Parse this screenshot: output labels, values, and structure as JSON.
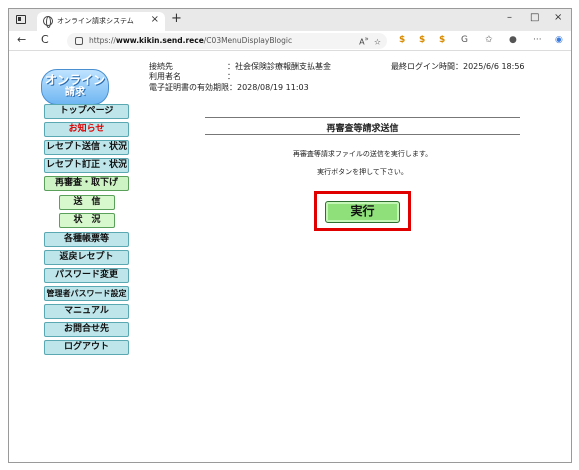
{
  "browser": {
    "tab_title": "オンライン請求システム",
    "tab_close": "×",
    "new_tab": "+",
    "window_controls": {
      "minimize": "–",
      "maximize": "□",
      "close": "×"
    },
    "url_prefix": "https://",
    "url_host": "www.kikin.send.rece",
    "url_path": "/C03MenuDisplayBlogic",
    "nav": {
      "back": "←",
      "reload": "C"
    }
  },
  "logo": {
    "line1": "オンライン",
    "line2": "請求"
  },
  "header": {
    "connection_label": "接続先",
    "connection_value": "：社会保険診療報酬支払基金",
    "user_label": "利用者名",
    "user_value": "：",
    "cert_label": "電子証明書の有効期限：2028/08/19 11:03",
    "last_login": "最終ログイン時間：2025/6/6 18:56"
  },
  "menu": {
    "top": "トップページ",
    "news": "お知らせ",
    "send_status": "レセプト送信・状況",
    "correction": "レセプト訂正・状況",
    "reexam": "再審査・取下げ",
    "sub_send": "送　信",
    "sub_status": "状　況",
    "forms": "各種帳票等",
    "returned": "返戻レセプト",
    "password": "パスワード変更",
    "admin_password": "管理者パスワード設定",
    "manual": "マニュアル",
    "contact": "お問合せ先",
    "logout": "ログアウト"
  },
  "main": {
    "title": "再審査等請求送信",
    "message1": "再審査等請求ファイルの送信を実行します。",
    "message2": "実行ボタンを押して下さい。",
    "execute_label": "実行"
  },
  "colors": {
    "menu_blue": "#bde5ea",
    "menu_green": "#cdf2c4",
    "execute_green": "#8fe07a",
    "highlight_red": "#e00000"
  }
}
